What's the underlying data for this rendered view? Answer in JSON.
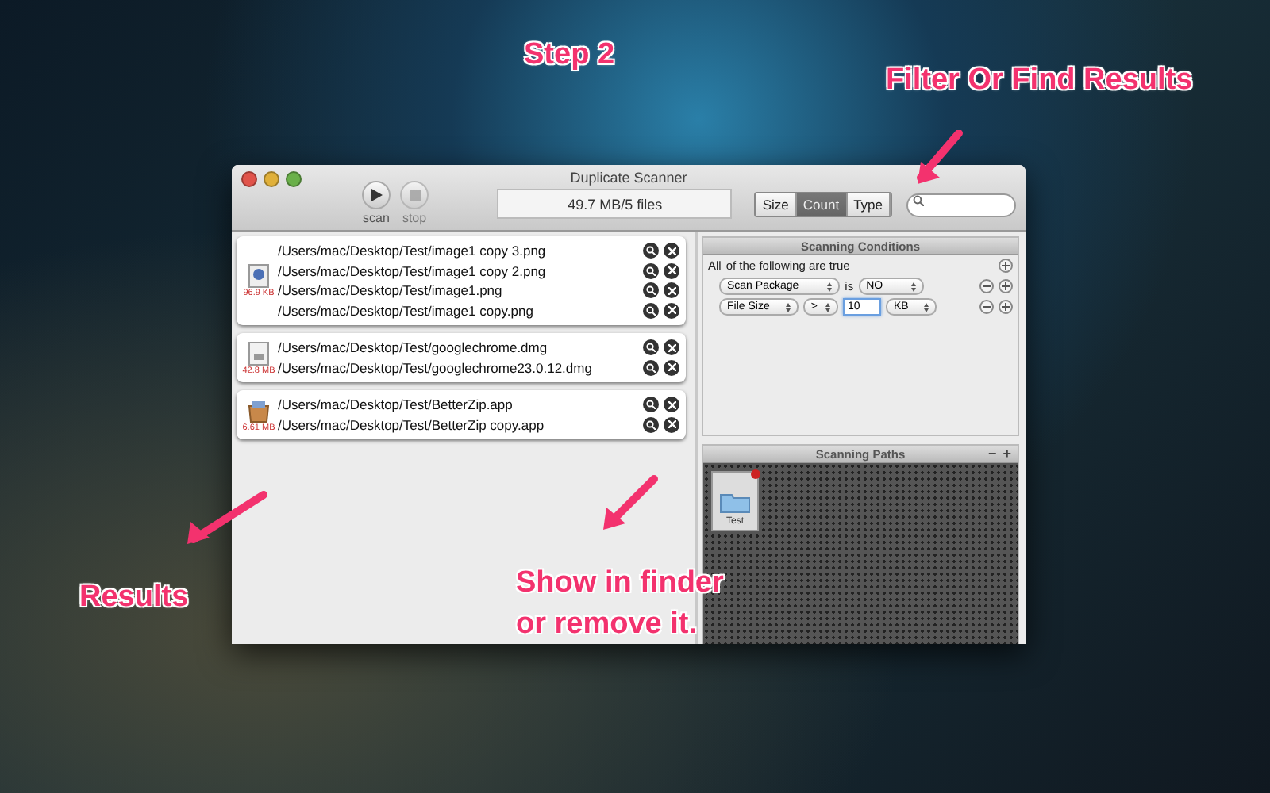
{
  "annotations": [
    {
      "text": "Step 2"
    },
    {
      "text": "Filter Or Find Results"
    },
    {
      "text": "Results"
    },
    {
      "text": "Show in finder\nor remove it."
    }
  ],
  "window": {
    "title": "Duplicate Scanner"
  },
  "toolbar": {
    "buttons": [
      {
        "label": "scan",
        "kind": "play",
        "disabled": false
      },
      {
        "label": "stop",
        "kind": "stop",
        "disabled": true
      }
    ],
    "status": "49.7 MB/5 files",
    "sort": [
      {
        "label": "Size",
        "selected": false
      },
      {
        "label": "Count",
        "selected": true
      },
      {
        "label": "Type",
        "selected": false
      }
    ]
  },
  "results": [
    {
      "size": "96.9 KB",
      "kind": "image",
      "files": [
        "/Users/mac/Desktop/Test/image1 copy 3.png",
        "/Users/mac/Desktop/Test/image1 copy 2.png",
        "/Users/mac/Desktop/Test/image1.png",
        "/Users/mac/Desktop/Test/image1 copy.png"
      ]
    },
    {
      "size": "42.8 MB",
      "kind": "disk",
      "files": [
        "/Users/mac/Desktop/Test/googlechrome.dmg",
        "/Users/mac/Desktop/Test/googlechrome23.0.12.dmg"
      ]
    },
    {
      "size": "6.61 MB",
      "kind": "app",
      "files": [
        "/Users/mac/Desktop/Test/BetterZip.app",
        "/Users/mac/Desktop/Test/BetterZip copy.app"
      ]
    }
  ],
  "conditions": {
    "title": "Scanning Conditions",
    "quantifier": "All",
    "text": "of the following are true",
    "rules": [
      {
        "parts": [
          {
            "kind": "popup",
            "text": "Scan Package"
          },
          {
            "kind": "label",
            "text": "is"
          },
          {
            "kind": "popup",
            "text": "NO"
          }
        ]
      },
      {
        "parts": [
          {
            "kind": "popup",
            "text": "File Size"
          },
          {
            "kind": "popup",
            "text": ">"
          },
          {
            "kind": "input",
            "text": "10"
          },
          {
            "kind": "popup",
            "text": "KB"
          }
        ]
      }
    ]
  },
  "paths": {
    "title": "Scanning Paths",
    "remove": "−",
    "add": "+",
    "items": [
      {
        "label": "Test"
      }
    ]
  }
}
